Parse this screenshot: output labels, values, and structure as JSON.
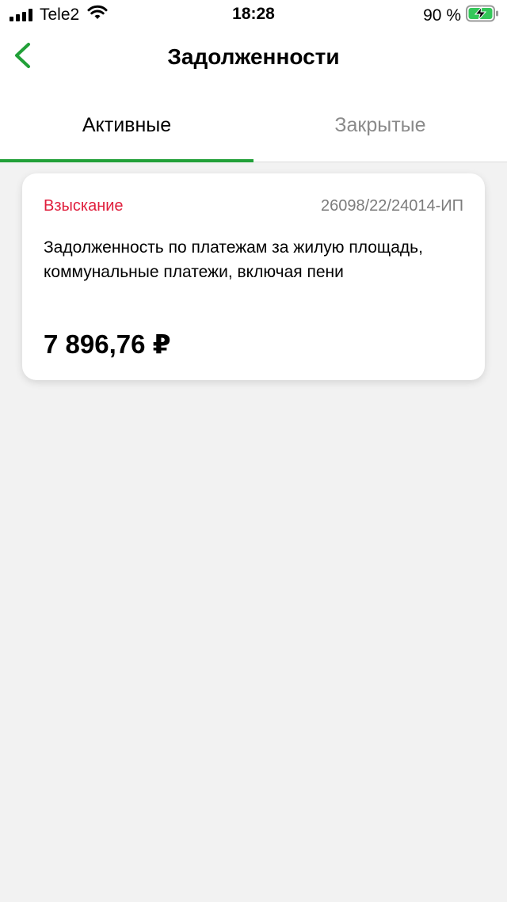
{
  "status_bar": {
    "carrier": "Tele2",
    "time": "18:28",
    "battery_percent": "90 %"
  },
  "header": {
    "title": "Задолженности",
    "back_icon": "chevron-left-icon"
  },
  "tabs": [
    {
      "label": "Активные",
      "active": true
    },
    {
      "label": "Закрытые",
      "active": false
    }
  ],
  "debts": [
    {
      "status": "Взыскание",
      "case_number": "26098/22/24014-ИП",
      "description": "Задолженность по платежам за жилую площадь, коммунальные платежи, включая пени",
      "amount": "7 896,76 ₽"
    }
  ],
  "colors": {
    "accent": "#21a038",
    "status_red": "#e01f3d",
    "background": "#f2f2f2"
  }
}
